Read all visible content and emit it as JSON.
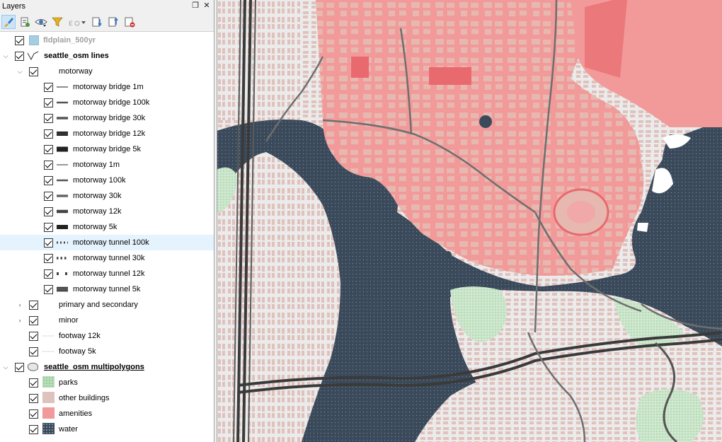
{
  "panel": {
    "title": "Layers",
    "float_glyph": "❐",
    "close_glyph": "✕"
  },
  "toolbar": {
    "icons": [
      "style-brush-icon",
      "add-group-icon",
      "eye-visibility-icon",
      "filter-icon",
      "expression-filter-icon",
      "expand-all-icon",
      "collapse-all-icon",
      "remove-layer-icon"
    ]
  },
  "layers": {
    "fldplain": {
      "label": "fldplain_500yr",
      "fill": "#a6cee3"
    },
    "lines_group": {
      "label": "seattle_osm lines",
      "motorway": {
        "label": "motorway",
        "items": [
          {
            "label": "motorway bridge 1m"
          },
          {
            "label": "motorway bridge 100k"
          },
          {
            "label": "motorway bridge 30k"
          },
          {
            "label": "motorway bridge 12k"
          },
          {
            "label": "motorway bridge 5k"
          },
          {
            "label": "motorway 1m"
          },
          {
            "label": "motorway 100k"
          },
          {
            "label": "motorway 30k"
          },
          {
            "label": "motorway 12k"
          },
          {
            "label": "motorway 5k"
          },
          {
            "label": "motorway tunnel 100k"
          },
          {
            "label": "motorway tunnel 30k"
          },
          {
            "label": "motorway tunnel 12k"
          },
          {
            "label": "motorway tunnel 5k"
          }
        ]
      },
      "primary": {
        "label": "primary and secondary"
      },
      "minor": {
        "label": "minor"
      },
      "footway12": {
        "label": "footway 12k"
      },
      "footway5": {
        "label": "footway 5k"
      }
    },
    "polygons_group": {
      "label": "seattle_osm multipolygons",
      "items": [
        {
          "label": "parks",
          "fill": "#b7ddb9"
        },
        {
          "label": "other buildings",
          "fill": "#e0c2bd"
        },
        {
          "label": "amenities",
          "fill": "#f29a9a"
        },
        {
          "label": "water",
          "fill": "#3b4a5a"
        }
      ]
    }
  },
  "map": {
    "colors": {
      "background": "#ebebeb",
      "water": "#3b4a5a",
      "amenities": "#f29a9a",
      "amenity_dark": "#e8696e",
      "buildings": "#e0c2bd",
      "parks": "#b7ddb9",
      "roads": "#6e6e6e",
      "motorway": "#3a3a3a",
      "minor_roads": "#ffffff"
    }
  }
}
